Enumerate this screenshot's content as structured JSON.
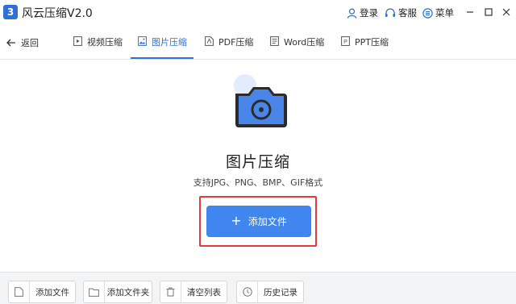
{
  "app": {
    "logo_text": "3",
    "title": "风云压缩V2.0",
    "brand_color": "#2f6fd8"
  },
  "titlebar": {
    "login_label": "登录",
    "service_label": "客服",
    "menu_label": "菜单",
    "icons": [
      "user-icon",
      "headset-icon",
      "menu-icon",
      "minimize-icon",
      "maximize-icon",
      "close-icon"
    ]
  },
  "tabbar": {
    "back_label": "返回",
    "tabs": [
      {
        "label": "视频压缩",
        "icon": "video-icon",
        "active": false
      },
      {
        "label": "图片压缩",
        "icon": "image-icon",
        "active": true
      },
      {
        "label": "PDF压缩",
        "icon": "pdf-icon",
        "active": false
      },
      {
        "label": "Word压缩",
        "icon": "word-icon",
        "active": false
      },
      {
        "label": "PPT压缩",
        "icon": "ppt-icon",
        "active": false
      }
    ]
  },
  "main": {
    "heading": "图片压缩",
    "formats": "支持JPG、PNG、BMP、GIF格式",
    "add_file_label": "添加文件",
    "add_file_icon": "plus-icon",
    "button_color": "#3f86ee",
    "highlight_color": "#e03a3a"
  },
  "bottombar": {
    "buttons": [
      {
        "label": "添加文件",
        "icon": "add-file-icon"
      },
      {
        "label": "添加文件夹",
        "icon": "add-folder-icon"
      },
      {
        "label": "清空列表",
        "icon": "trash-icon"
      },
      {
        "label": "历史记录",
        "icon": "history-icon"
      }
    ]
  }
}
